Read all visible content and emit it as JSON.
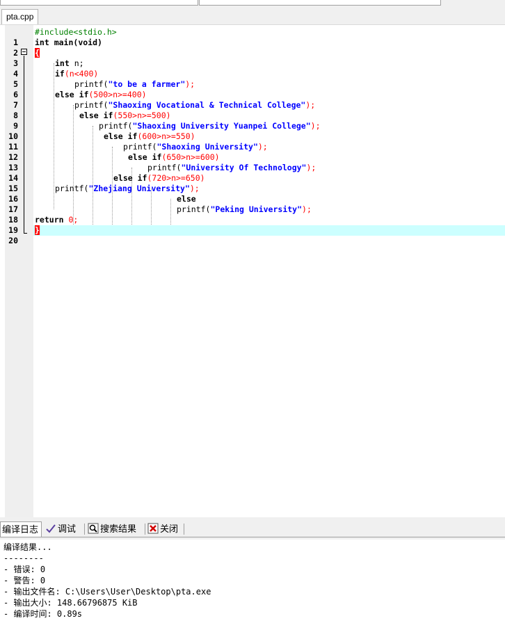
{
  "file_tab": "pta.cpp",
  "code_lines": [
    "1",
    "2",
    "3",
    "4",
    "5",
    "6",
    "7",
    "8",
    "9",
    "10",
    "11",
    "12",
    "13",
    "14",
    "15",
    "16",
    "17",
    "18",
    "19",
    "20"
  ],
  "code": {
    "l1": "#include<stdio.h>",
    "l2_kw": "int",
    "l2_rest": " main(void)",
    "l3": "{",
    "l4_kw": "int",
    "l4_rest": " n;",
    "l5_kw": "if",
    "l5_cond": "(n<400)",
    "l6_fn": "printf(",
    "l6_str": "\"to be a farmer\"",
    "l6_end": ");",
    "l7_kw": "else if",
    "l7_cond": "(500>n>=400)",
    "l8_fn": "printf(",
    "l8_str": "\"Shaoxing Vocational & Technical College\"",
    "l8_end": ");",
    "l9_kw": "else if",
    "l9_cond": "(550>n>=500)",
    "l10_fn": "printf(",
    "l10_str": "\"Shaoxing University Yuanpei College\"",
    "l10_end": ");",
    "l11_kw": "else if",
    "l11_cond": "(600>n>=550)",
    "l12_fn": "printf(",
    "l12_str": "\"Shaoxing University\"",
    "l12_end": ");",
    "l13_kw": "else if",
    "l13_cond": "(650>n>=600)",
    "l14_fn": "printf(",
    "l14_str": "\"University Of Technology\"",
    "l14_end": ");",
    "l15_kw": "else if",
    "l15_cond": "(720>n>=650)",
    "l16_fn": "printf(",
    "l16_str": "\"Zhejiang University\"",
    "l16_end": ");",
    "l17_kw": "else",
    "l18_fn": "printf(",
    "l18_str": "\"Peking University\"",
    "l18_end": ");",
    "l19_kw": "return",
    "l19_num": "0",
    "l19_end": ";",
    "l20": "}"
  },
  "bottom_tabs": {
    "compile_log": "编译日志",
    "debug": "调试",
    "search_results": "搜索结果",
    "close": "关闭"
  },
  "log": {
    "l1": "编译结果...",
    "l2": "--------",
    "l3": "- 错误: 0",
    "l4": "- 警告: 0",
    "l5": "- 输出文件名: C:\\Users\\User\\Desktop\\pta.exe",
    "l6": "- 输出大小: 148.66796875 KiB",
    "l7": "- 编译时间: 0.89s"
  },
  "icons": {
    "debug": "checkmark-icon",
    "search": "magnifier-icon",
    "close": "close-window-icon"
  },
  "colors": {
    "keyword": "#000000",
    "string": "#0000ff",
    "number": "#ff0000",
    "preprocessor": "#008000",
    "current_line": "#ccffff"
  }
}
